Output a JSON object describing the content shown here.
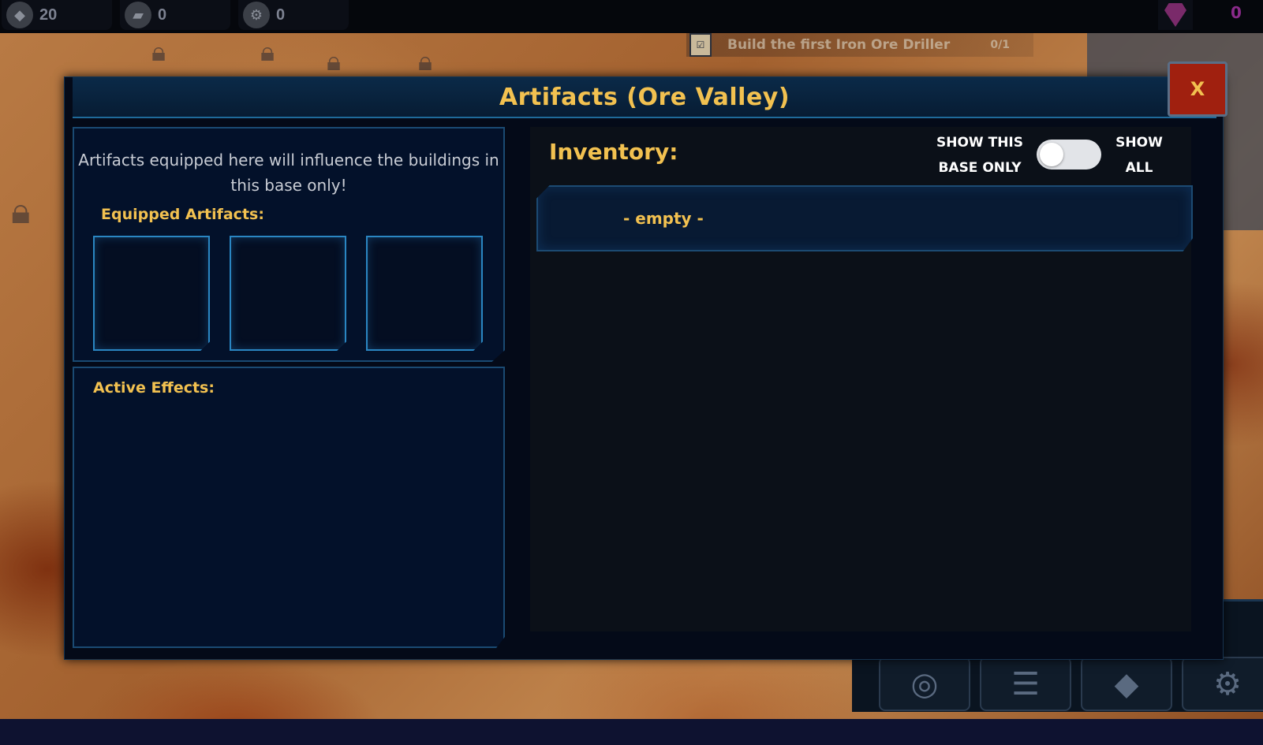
{
  "resources": [
    {
      "icon": "ore-icon",
      "value": "20"
    },
    {
      "icon": "iron-ingot-icon",
      "value": "0"
    },
    {
      "icon": "gear-coin-icon",
      "value": "0"
    }
  ],
  "premium": {
    "icon": "gem-icon",
    "value": "0"
  },
  "quest": {
    "text": "Build the first Iron Ore Driller",
    "progress": "0/1"
  },
  "dialog": {
    "title": "Artifacts (Ore Valley)",
    "close_label": "X",
    "description": "Artifacts equipped here will influence the buildings in this base only!",
    "equipped_label": "Equipped Artifacts:",
    "active_effects_label": "Active Effects:",
    "inventory_label": "Inventory:",
    "toggle_left_label": "SHOW THIS BASE ONLY",
    "toggle_right_label": "SHOW ALL",
    "toggle_state": "show-this-base-only",
    "empty_text": "- empty -"
  },
  "colors": {
    "accent_gold": "#f2c150",
    "close_red": "#a0200f",
    "panel_border": "#1a4a72",
    "panel_bg": "#03112a"
  }
}
